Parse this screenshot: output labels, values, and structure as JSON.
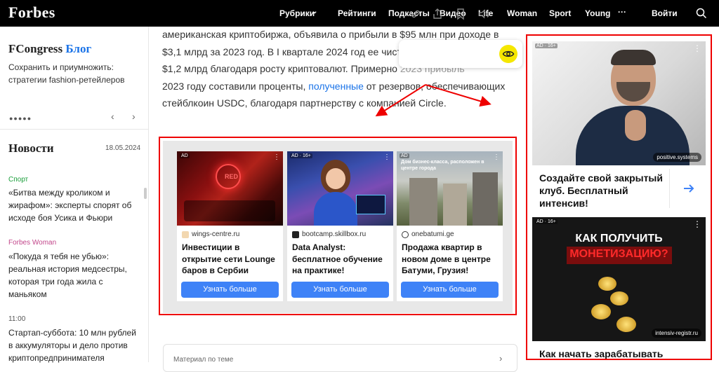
{
  "header": {
    "logo": "Forbes",
    "nav": [
      "Рубрики",
      "Рейтинги",
      "Подкасты",
      "Видео",
      "Life",
      "Woman",
      "Sport",
      "Young",
      "···"
    ],
    "login": "Войти"
  },
  "sidebar": {
    "blog_title_main": "FCongress",
    "blog_title_accent": "Блог",
    "blog_desc": "Сохранить и приумножить: стратегии fashion-ретейлеров",
    "dots": "●●●●●",
    "news_title": "Новости",
    "news_date": "18.05.2024",
    "news": [
      {
        "cat": "Спорт",
        "cat_color": "#1a9e3a",
        "text": "«Битва между кроликом и жирафом»: эксперты спорят об исходе боя Усика и Фьюри"
      },
      {
        "cat": "Forbes Woman",
        "cat_color": "#c2478b",
        "text": "«Покуда я тебя не убью»: реальная история медсестры, которая три года жила с маньяком"
      },
      {
        "cat": "11:00",
        "cat_color": "#555555",
        "text": "Стартап-суббота: 10 млн рублей в аккумуляторы и дело против криптопредпринимателя"
      }
    ]
  },
  "article": {
    "p1": "американская криптобиржа, объявила о прибыли в $95 млн при доходе в $3,1 млрд за 2023 год. В I квартале 2024 год ее чист",
    "p2": "$1,2 млрд благодаря росту криптовалют. Примерно ",
    "p2b": "2023 году составили проценты, ",
    "link": "полученные",
    "p3": " от резервов, обеспечивающих стейблкоин USDC, благодаря партнерству с компанией Circle."
  },
  "toolbar": {
    "icons": [
      "link-icon",
      "share-icon",
      "bookmark-icon",
      "audio-icon",
      "eye-icon"
    ]
  },
  "ads": [
    {
      "tag": "AD",
      "domain": "wings-centre.ru",
      "headline": "Инвестиции в открытие сети Lounge баров в Сербии",
      "button": "Узнать больше"
    },
    {
      "tag": "AD · 16+",
      "domain": "bootcamp.skillbox.ru",
      "headline": "Data Analyst: бесплатное обучение на практике!",
      "button": "Узнать больше"
    },
    {
      "tag": "AD",
      "img_caption": "Дом бизнес-класса, расположен в центре города",
      "domain": "onebatumi.ge",
      "headline": "Продажа квартир в новом доме в центре Батуми, Грузия!",
      "button": "Узнать больше"
    }
  ],
  "related": {
    "label": "Материал по теме"
  },
  "right_ads": [
    {
      "tag": "AD · 16+",
      "domain": "positive.systems",
      "headline": "Создайте свой закрытый клуб. Бесплатный интенсив!"
    },
    {
      "tag": "AD · 16+",
      "img_title_1": "КАК ПОЛУЧИТЬ",
      "img_title_2": "МОНЕТИЗАЦИЮ?",
      "domain": "intensiv-registr.ru",
      "headline": "Как начать зарабатывать"
    }
  ],
  "colors": {
    "accent": "#1a73e8",
    "annotation": "#e00000",
    "ad_button": "#3e82f7",
    "toolbar_highlight": "#f5e700"
  }
}
